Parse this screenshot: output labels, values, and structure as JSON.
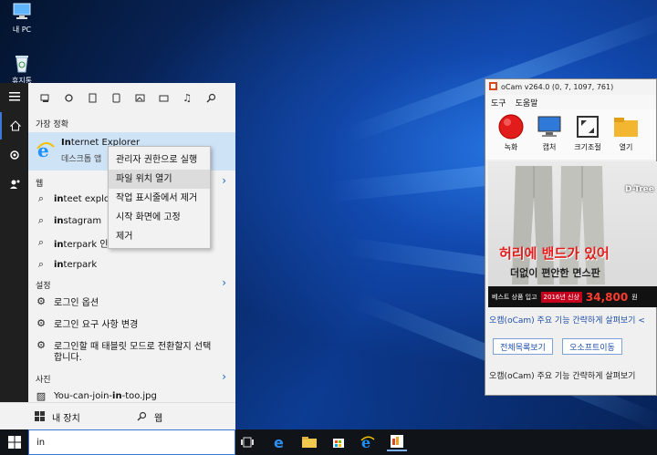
{
  "desktop": {
    "icons": [
      {
        "label": "내 PC",
        "icon": "computer-icon"
      },
      {
        "label": "휴지통",
        "icon": "recycle-bin-icon"
      }
    ]
  },
  "start_menu": {
    "rail": [
      "hamburger-icon",
      "home-icon",
      "gear-icon",
      "user-icon"
    ],
    "filters": [
      "apps-icon",
      "settings-icon",
      "photos-icon",
      "docs-icon",
      "video-icon",
      "folder-icon",
      "music-icon",
      "search-icon"
    ],
    "best_match_header": "가장 정확",
    "best_match": {
      "name_bold": "In",
      "name_rest": "ternet Explorer",
      "subtitle": "데스크톱 앱"
    },
    "web_header": "웹",
    "web_items": [
      {
        "bold": "in",
        "rest": "teet explore"
      },
      {
        "bold": "in",
        "rest": "stagram"
      },
      {
        "bold": "in",
        "rest": "terpark 인터"
      },
      {
        "bold": "in",
        "rest": "terpark"
      }
    ],
    "settings_header": "설정",
    "settings_items": [
      "로그인 옵션",
      "로그인 요구 사항 변경",
      "로그인할 때 태블릿 모드로 전환할지 선택",
      "합니다."
    ],
    "photos_header": "사진",
    "photo_item": {
      "before": "You-can-join-",
      "bold": "in",
      "after": "-too.jpg"
    },
    "bottom_tabs": [
      {
        "label": "내 장치",
        "icon": "windows-icon"
      },
      {
        "label": "웹",
        "icon": "search-icon"
      }
    ],
    "search_value": "in",
    "context_menu": [
      "관리자 권한으로 실행",
      "파일 위치 열기",
      "작업 표시줄에서 제거",
      "시작 화면에 고정",
      "제거"
    ]
  },
  "ocam": {
    "title": "oCam v264.0 (0, 7, 1097, 761)",
    "menu": [
      "도구",
      "도움말"
    ],
    "tools": [
      "녹화",
      "캡처",
      "크기조절",
      "열기"
    ],
    "ad": {
      "brand": "D-Tree",
      "headline": "허리에 밴드가 있어",
      "subline": "더없이 편안한 면스판",
      "strip_text": "베스트 상품 입고",
      "badge": "2016년 신상",
      "price": "34,800",
      "currency": "원"
    },
    "link1": "오캠(oCam) 주요 기능 간략하게 살펴보기",
    "link1_suffix": "<",
    "buttons": [
      "전체목록보기",
      "오소프트이동"
    ],
    "text": "오캠(oCam) 주요 기능 간략하게 살펴보기"
  },
  "colors": {
    "accent": "#3b78d8",
    "highlight": "#cfe3f7",
    "taskbar": "#101418",
    "rail": "#1f1f1f"
  }
}
